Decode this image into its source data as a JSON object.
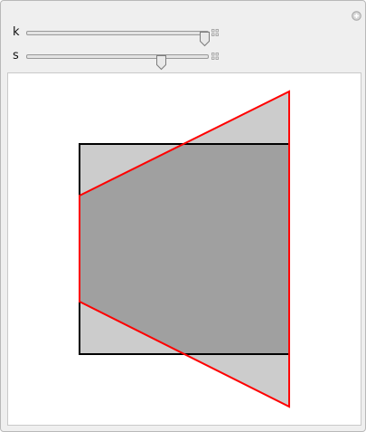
{
  "controls": [
    {
      "label": "k",
      "value_fraction": 0.98
    },
    {
      "label": "s",
      "value_fraction": 0.74
    }
  ],
  "colors": {
    "panel_background": "#efefef",
    "plot_background": "#ffffff",
    "square_fill": "#cccccc",
    "overlap_fill": "#a0a0a0",
    "square_stroke": "#000000",
    "trapezoid_stroke": "#ff0000"
  },
  "icons": {
    "add": "plus-circle-icon",
    "slider_options": "slider-options-icon"
  }
}
